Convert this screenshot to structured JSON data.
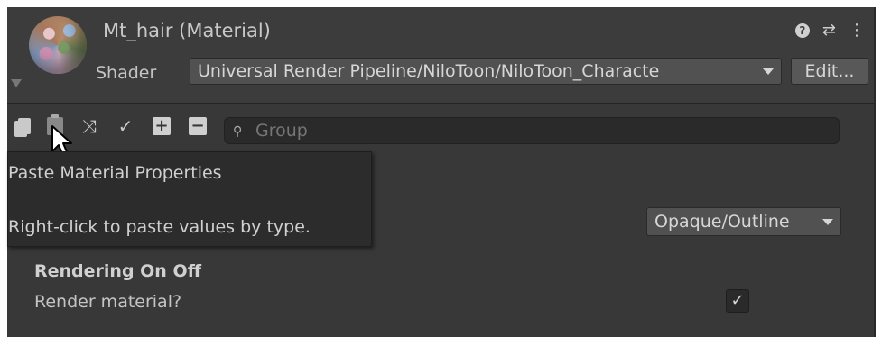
{
  "header": {
    "title": "Mt_hair (Material)",
    "shader_label": "Shader",
    "shader_value": "Universal Render Pipeline/NiloToon/NiloToon_Characte",
    "edit_button": "Edit...",
    "icons": [
      "help-icon",
      "presets-icon",
      "more-options-icon"
    ]
  },
  "toolbar": {
    "icons": [
      "copy-icon",
      "paste-icon",
      "collapse-icon",
      "check-icon",
      "expand-icon",
      "collapse-all-icon"
    ],
    "search_placeholder": "Group"
  },
  "tooltip": {
    "title": "Paste Material Properties",
    "body": "Right-click to paste values by type."
  },
  "surface": {
    "mode_value": "Opaque/Outline"
  },
  "rendering": {
    "section_title": "Rendering On Off",
    "render_label": "Render material?",
    "render_checked": true
  },
  "colors": {
    "panel_bg": "#383838",
    "header_bg": "#3c3c3c",
    "tooltip_bg": "#2c2c2c"
  }
}
